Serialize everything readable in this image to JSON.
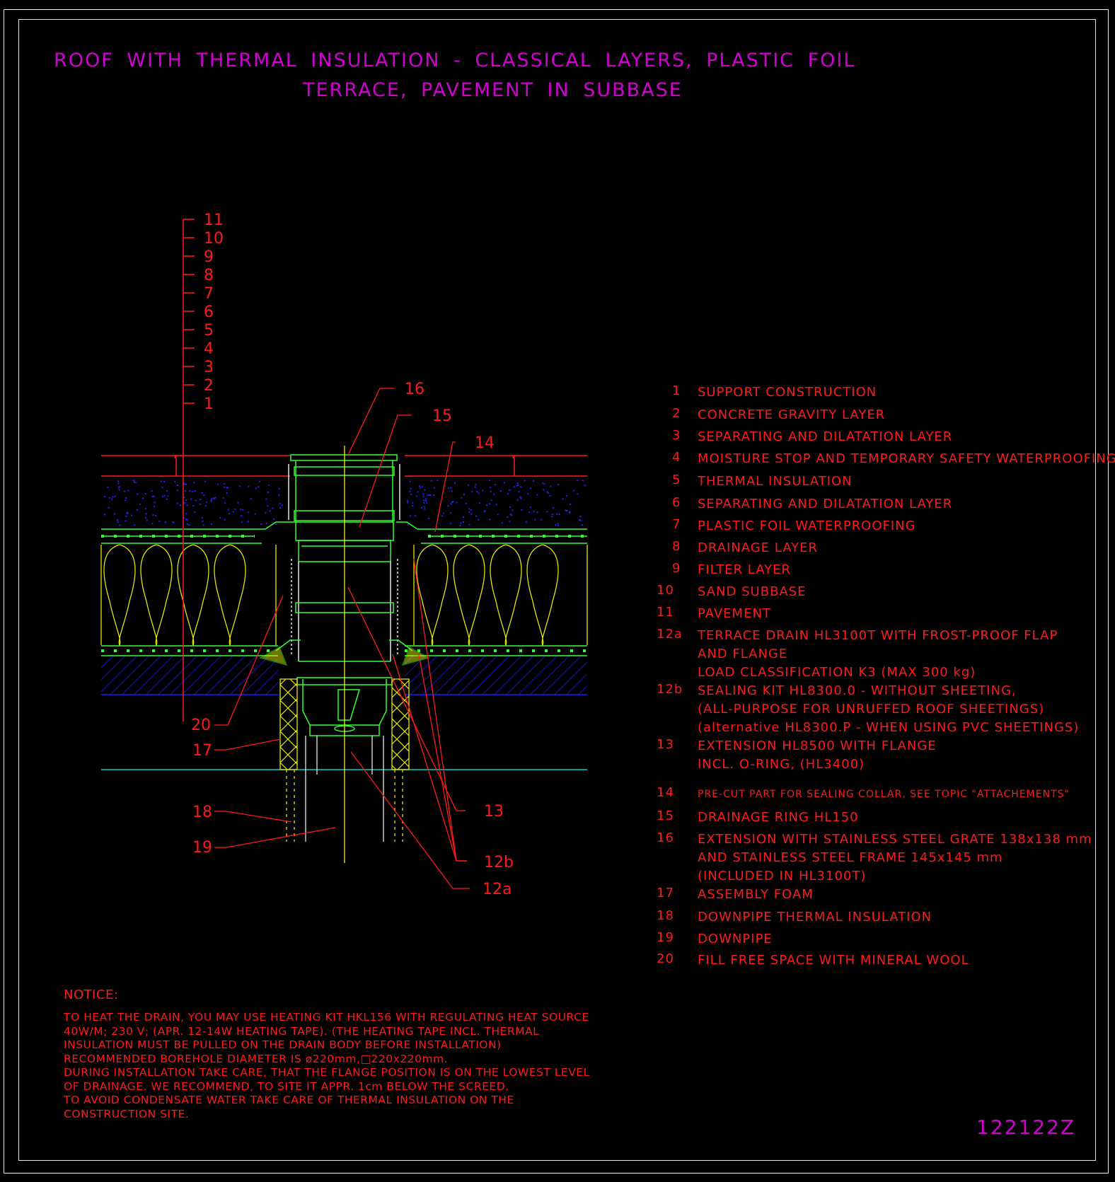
{
  "title": {
    "line1": "ROOF WITH THERMAL INSULATION - CLASSICAL LAYERS, PLASTIC FOIL",
    "line2": "TERRACE, PAVEMENT IN SUBBASE"
  },
  "colors": {
    "background": "#000000",
    "title": "#d100d1",
    "annotation": "#ff1a1a",
    "drain": "#33ff33",
    "insulation": "#e6e600",
    "gravel": "#2222ff",
    "screed": "#1a1aff",
    "centerline": "#ffff33",
    "ground": "#00d0d0"
  },
  "layer_scale": [
    "11",
    "10",
    "9",
    "8",
    "7",
    "6",
    "5",
    "4",
    "3",
    "2",
    "1"
  ],
  "callouts": {
    "c16": "16",
    "c15": "15",
    "c14": "14",
    "c20": "20",
    "c17": "17",
    "c18": "18",
    "c19": "19",
    "c13": "13",
    "c12b": "12b",
    "c12a": "12a"
  },
  "legend": [
    {
      "num": "1",
      "lines": [
        "SUPPORT CONSTRUCTION"
      ]
    },
    {
      "num": "2",
      "lines": [
        "CONCRETE GRAVITY LAYER"
      ]
    },
    {
      "num": "3",
      "lines": [
        "SEPARATING AND DILATATION LAYER"
      ]
    },
    {
      "num": "4",
      "lines": [
        "MOISTURE STOP AND TEMPORARY SAFETY WATERPROOFING"
      ]
    },
    {
      "num": "5",
      "lines": [
        "THERMAL INSULATION"
      ]
    },
    {
      "num": "6",
      "lines": [
        "SEPARATING AND DILATATION LAYER"
      ]
    },
    {
      "num": "7",
      "lines": [
        "PLASTIC FOIL WATERPROOFING"
      ]
    },
    {
      "num": "8",
      "lines": [
        "DRAINAGE LAYER"
      ]
    },
    {
      "num": "9",
      "lines": [
        "FILTER LAYER"
      ]
    },
    {
      "num": "10",
      "lines": [
        "SAND SUBBASE"
      ]
    },
    {
      "num": "11",
      "lines": [
        "PAVEMENT"
      ]
    },
    {
      "num": "12a",
      "lines": [
        "TERRACE DRAIN HL3100T WITH FROST-PROOF FLAP",
        "AND FLANGE",
        "LOAD CLASSIFICATION K3 (MAX 300 kg)"
      ]
    },
    {
      "num": "12b",
      "lines": [
        "SEALING KIT HL8300.0 - WITHOUT SHEETING,",
        "(ALL-PURPOSE FOR UNRUFFED ROOF SHEETINGS)",
        "(alternative HL8300.P - WHEN USING PVC SHEETINGS)"
      ]
    },
    {
      "num": "13",
      "lines": [
        "EXTENSION HL8500 WITH FLANGE",
        "INCL. O-RING, (HL3400)"
      ]
    },
    {
      "num": "14",
      "lines": [
        "PRE-CUT PART FOR SEALING COLLAR, SEE TOPIC \"ATTACHEMENTS\""
      ]
    },
    {
      "num": "15",
      "lines": [
        "DRAINAGE RING HL150"
      ]
    },
    {
      "num": "16",
      "lines": [
        "EXTENSION WITH STAINLESS STEEL GRATE 138x138 mm",
        "AND STAINLESS STEEL FRAME 145x145 mm",
        "(INCLUDED IN HL3100T)"
      ]
    },
    {
      "num": "17",
      "lines": [
        "ASSEMBLY FOAM"
      ]
    },
    {
      "num": "18",
      "lines": [
        "DOWNPIPE THERMAL INSULATION"
      ]
    },
    {
      "num": "19",
      "lines": [
        "DOWNPIPE"
      ]
    },
    {
      "num": "20",
      "lines": [
        "FILL FREE SPACE WITH MINERAL WOOL"
      ]
    }
  ],
  "notice": {
    "heading": "NOTICE:",
    "lines": [
      "TO HEAT THE DRAIN, YOU MAY USE HEATING KIT HKL156 WITH REGULATING HEAT SOURCE",
      "40W/M; 230 V;  (APR. 12-14W HEATING TAPE). (THE HEATING TAPE INCL. THERMAL",
      "INSULATION MUST BE PULLED ON THE DRAIN BODY BEFORE INSTALLATION)",
      "RECOMMENDED BOREHOLE DIAMETER IS ø220mm,□220x220mm.",
      "DURING INSTALLATION TAKE CARE, THAT THE FLANGE POSITION IS ON THE LOWEST LEVEL",
      "OF DRAINAGE. WE RECOMMEND, TO SITE IT APPR. 1cm BELOW THE SCREED.",
      "TO AVOID CONDENSATE WATER TAKE CARE OF THERMAL INSULATION ON THE",
      "CONSTRUCTION SITE."
    ]
  },
  "drawing_code": "122122Z"
}
